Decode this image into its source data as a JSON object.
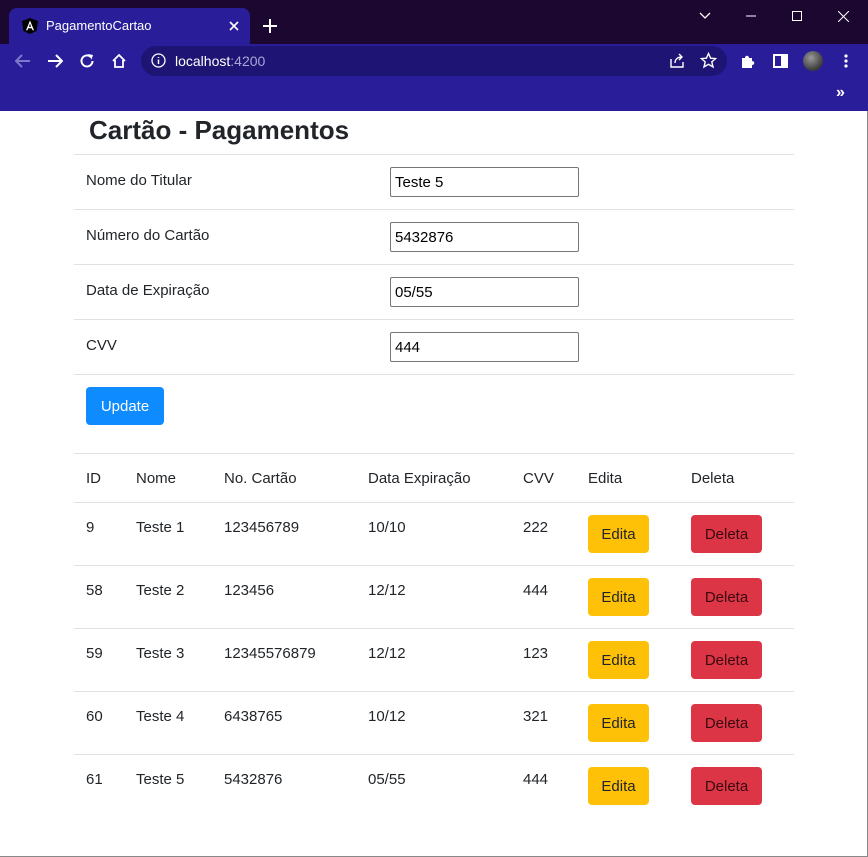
{
  "browser": {
    "tab_title": "PagamentoCartao",
    "url_host": "localhost",
    "url_port": ":4200",
    "new_tab_symbol": "+",
    "overflow_symbol": "»"
  },
  "page": {
    "title": "Cartão - Pagamentos",
    "form": {
      "fields": [
        {
          "label": "Nome do Titular",
          "value": "Teste 5"
        },
        {
          "label": "Número do Cartão",
          "value": "5432876"
        },
        {
          "label": "Data de Expiração",
          "value": "05/55"
        },
        {
          "label": "CVV",
          "value": "444"
        }
      ],
      "submit_label": "Update"
    },
    "table": {
      "headers": [
        "ID",
        "Nome",
        "No. Cartão",
        "Data Expiração",
        "CVV",
        "Edita",
        "Deleta"
      ],
      "rows": [
        {
          "id": "9",
          "nome": "Teste 1",
          "cartao": "123456789",
          "expiracao": "10/10",
          "cvv": "222",
          "edit_label": "Edita",
          "delete_label": "Deleta"
        },
        {
          "id": "58",
          "nome": "Teste 2",
          "cartao": "123456",
          "expiracao": "12/12",
          "cvv": "444",
          "edit_label": "Edita",
          "delete_label": "Deleta"
        },
        {
          "id": "59",
          "nome": "Teste 3",
          "cartao": "12345576879",
          "expiracao": "12/12",
          "cvv": "123",
          "edit_label": "Edita",
          "delete_label": "Deleta"
        },
        {
          "id": "60",
          "nome": "Teste 4",
          "cartao": "6438765",
          "expiracao": "10/12",
          "cvv": "321",
          "edit_label": "Edita",
          "delete_label": "Deleta"
        },
        {
          "id": "61",
          "nome": "Teste 5",
          "cartao": "5432876",
          "expiracao": "05/55",
          "cvv": "444",
          "edit_label": "Edita",
          "delete_label": "Deleta"
        }
      ]
    }
  },
  "colors": {
    "titlebar": "#1b0730",
    "toolbar": "#2a1d9a",
    "primary_button": "#0d8bff",
    "edit_button": "#ffc107",
    "delete_button": "#dc3545"
  }
}
